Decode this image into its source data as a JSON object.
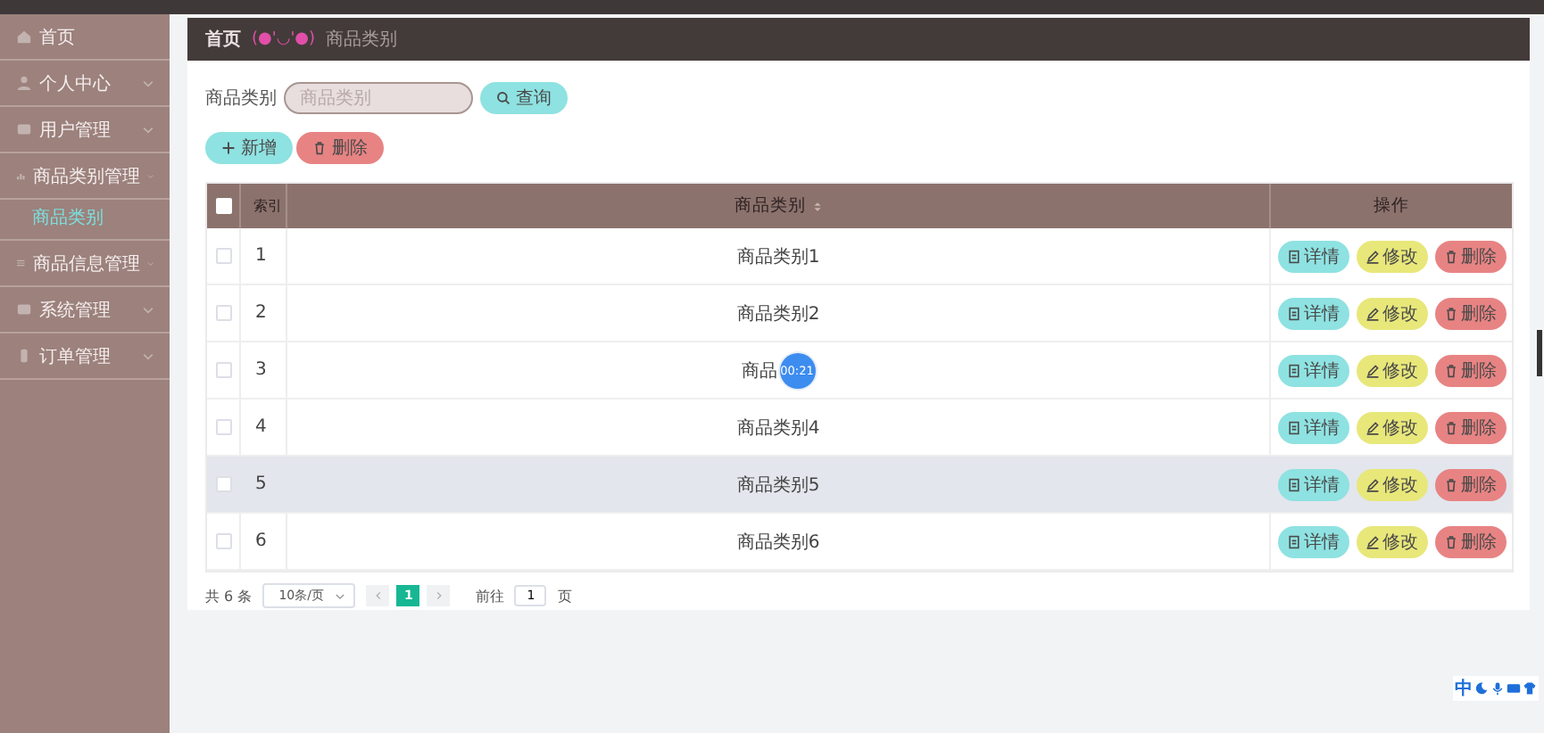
{
  "sidebar": {
    "items": [
      {
        "label": "首页",
        "kind": "link"
      },
      {
        "label": "个人中心",
        "kind": "group"
      },
      {
        "label": "用户管理",
        "kind": "group"
      },
      {
        "label": "商品类别管理",
        "kind": "group",
        "children": [
          {
            "label": "商品类别",
            "selected": true
          }
        ]
      },
      {
        "label": "商品信息管理",
        "kind": "group"
      },
      {
        "label": "系统管理",
        "kind": "group"
      },
      {
        "label": "订单管理",
        "kind": "group"
      }
    ]
  },
  "breadcrumb": {
    "home": "首页",
    "emoticon": "(●'◡'●)",
    "current": "商品类别"
  },
  "search": {
    "label": "商品类别",
    "placeholder": "商品类别",
    "button": "查询"
  },
  "actions": [
    {
      "label": "新增",
      "kind": "add"
    },
    {
      "label": "删除",
      "kind": "delete"
    }
  ],
  "table": {
    "columns": [
      "索引",
      "商品类别",
      "操作"
    ],
    "select_all_checked": false,
    "rows": [
      {
        "index": "1",
        "name": "商品类别1",
        "hover": false,
        "checked": false,
        "buttons": [
          {
            "label": "详情",
            "kind": "detail"
          },
          {
            "label": "修改",
            "kind": "edit"
          },
          {
            "label": "删除",
            "kind": "delete"
          }
        ]
      },
      {
        "index": "2",
        "name": "商品类别2",
        "hover": false,
        "checked": false,
        "buttons": [
          {
            "label": "详情",
            "kind": "detail"
          },
          {
            "label": "修改",
            "kind": "edit"
          },
          {
            "label": "删除",
            "kind": "delete"
          }
        ]
      },
      {
        "index": "3",
        "name": "商品",
        "timer": "00:21",
        "hover": false,
        "checked": false,
        "buttons": [
          {
            "label": "详情",
            "kind": "detail"
          },
          {
            "label": "修改",
            "kind": "edit"
          },
          {
            "label": "删除",
            "kind": "delete"
          }
        ]
      },
      {
        "index": "4",
        "name": "商品类别4",
        "hover": false,
        "checked": false,
        "buttons": [
          {
            "label": "详情",
            "kind": "detail"
          },
          {
            "label": "修改",
            "kind": "edit"
          },
          {
            "label": "删除",
            "kind": "delete"
          }
        ]
      },
      {
        "index": "5",
        "name": "商品类别5",
        "hover": true,
        "checked": false,
        "buttons": [
          {
            "label": "详情",
            "kind": "detail"
          },
          {
            "label": "修改",
            "kind": "edit"
          },
          {
            "label": "删除",
            "kind": "delete"
          }
        ]
      },
      {
        "index": "6",
        "name": "商品类别6",
        "hover": false,
        "checked": false,
        "buttons": [
          {
            "label": "详情",
            "kind": "detail"
          },
          {
            "label": "修改",
            "kind": "edit"
          },
          {
            "label": "删除",
            "kind": "delete"
          }
        ]
      }
    ]
  },
  "pagination": {
    "total": "共 6 条",
    "page_size": "10条/页",
    "pages": [
      {
        "label": "1",
        "selected": true
      }
    ],
    "goto_label": "前往",
    "goto_value": "1",
    "page_suffix": "页"
  },
  "ime_bar": {
    "label": "中"
  }
}
